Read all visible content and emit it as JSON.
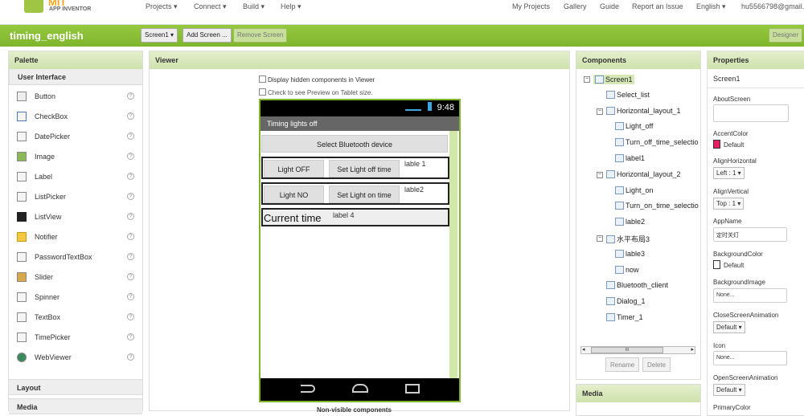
{
  "topbar": {
    "logo_mit": "MIT",
    "logo_sub": "APP INVENTOR",
    "menus": [
      "Projects ▾",
      "Connect ▾",
      "Build ▾",
      "Help ▾"
    ],
    "right_links": [
      "My Projects",
      "Gallery",
      "Guide",
      "Report an Issue",
      "English ▾",
      "hu5566798@gmail."
    ]
  },
  "toolbar": {
    "project_name": "timing_english",
    "screen_select": "Screen1 ▾",
    "add_screen": "Add Screen ...",
    "remove_screen": "Remove Screen",
    "designer": "Designer"
  },
  "palette": {
    "title": "Palette",
    "section": "User Interface",
    "items": [
      "Button",
      "CheckBox",
      "DatePicker",
      "Image",
      "Label",
      "ListPicker",
      "ListView",
      "Notifier",
      "PasswordTextBox",
      "Slider",
      "Spinner",
      "TextBox",
      "TimePicker",
      "WebViewer"
    ],
    "help_glyph": "?",
    "layout": "Layout",
    "media": "Media"
  },
  "viewer": {
    "title": "Viewer",
    "hidden_cb": "Display hidden components in Viewer",
    "tablet_cb": "Check to see Preview on Tablet size.",
    "status_time": "9:48",
    "app_title": "Timing lights off",
    "select_bt": "Select Bluetooth device",
    "light_off": "Light OFF",
    "set_off": "Set Light off time",
    "lable1": "lable 1",
    "light_on": "Light NO",
    "set_on": "Set Light on time",
    "lable2": "lable2",
    "current_time": "Current time",
    "label4": "label 4",
    "nonvisible": "Non-visible components"
  },
  "components": {
    "title": "Components",
    "tree": [
      {
        "label": "Screen1",
        "depth": 0,
        "toggle": "−"
      },
      {
        "label": "Select_list",
        "depth": 1,
        "toggle": ""
      },
      {
        "label": "Horizontal_layout_1",
        "depth": 1,
        "toggle": "−"
      },
      {
        "label": "Light_off",
        "depth": 2,
        "toggle": ""
      },
      {
        "label": "Turn_off_time_selectio",
        "depth": 2,
        "toggle": ""
      },
      {
        "label": "label1",
        "depth": 2,
        "toggle": ""
      },
      {
        "label": "Horizontal_layout_2",
        "depth": 1,
        "toggle": "−"
      },
      {
        "label": "Light_on",
        "depth": 2,
        "toggle": ""
      },
      {
        "label": "Turn_on_time_selectio",
        "depth": 2,
        "toggle": ""
      },
      {
        "label": "lable2",
        "depth": 2,
        "toggle": ""
      },
      {
        "label": "水平布局3",
        "depth": 1,
        "toggle": "−"
      },
      {
        "label": "lable3",
        "depth": 2,
        "toggle": ""
      },
      {
        "label": "now",
        "depth": 2,
        "toggle": ""
      },
      {
        "label": "Bluetooth_client",
        "depth": 1,
        "toggle": ""
      },
      {
        "label": "Dialog_1",
        "depth": 1,
        "toggle": ""
      },
      {
        "label": "Timer_1",
        "depth": 1,
        "toggle": ""
      }
    ],
    "rename": "Rename",
    "delete": "Delete",
    "media": "Media",
    "scroll_thumb": "III",
    "scroll_left": "◂",
    "scroll_right": "▸"
  },
  "properties": {
    "title": "Properties",
    "screen": "Screen1",
    "about_label": "AboutScreen",
    "accent_label": "AccentColor",
    "accent_value": "Default",
    "accent_color": "#e91e63",
    "alignh_label": "AlignHorizontal",
    "alignh_value": "Left : 1 ▾",
    "alignv_label": "AlignVertical",
    "alignv_value": "Top : 1 ▾",
    "appname_label": "AppName",
    "appname_value": "定时关灯",
    "bgcolor_label": "BackgroundColor",
    "bgcolor_value": "Default",
    "bgimage_label": "BackgroundImage",
    "bgimage_value": "None...",
    "close_label": "CloseScreenAnimation",
    "close_value": "Default ▾",
    "icon_label": "Icon",
    "icon_value": "None...",
    "open_label": "OpenScreenAnimation",
    "open_value": "Default ▾",
    "primary_label": "PrimaryColor"
  }
}
